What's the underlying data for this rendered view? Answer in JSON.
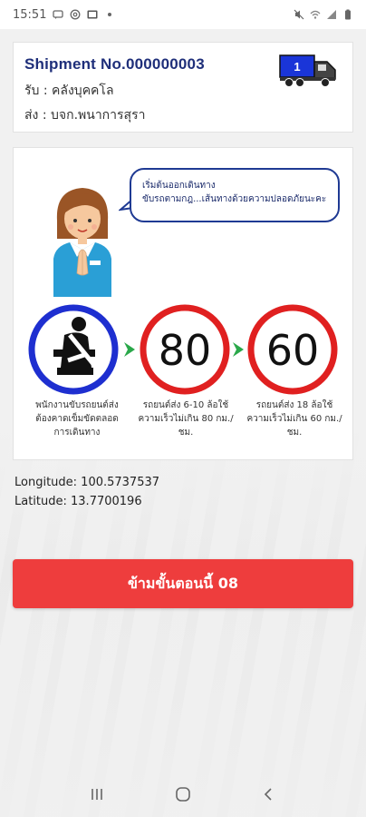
{
  "status_bar": {
    "time": "15:51",
    "icons_left": [
      "message-icon",
      "at-icon",
      "gallery-icon",
      "dot-icon"
    ],
    "icons_right": [
      "mute-icon",
      "wifi-icon",
      "signal-icon",
      "battery-icon"
    ]
  },
  "shipment": {
    "title": "Shipment No.000000003",
    "pickup": "รับ : คลังบุคคโล",
    "deliver": "ส่ง : บจก.พนาการสุรา",
    "truck_number": "1"
  },
  "safety": {
    "bubble_line1": "เริ่มต้นออกเดินทาง",
    "bubble_line2": "ขับรถตามกฎ...เส้นทางด้วยความปลอดภัยนะคะ",
    "seatbelt_caption": "พนักงานขับรถยนต์ส่ง ต้องคาดเข็มขัดตลอด การเดินทาง",
    "sign1_value": "80",
    "sign1_caption": "รถยนต์ส่ง 6-10 ล้อใช้ ความเร็วไม่เกิน 80 กม./ ชม.",
    "sign2_value": "60",
    "sign2_caption": "รถยนต์ส่ง 18 ล้อใช้ ความเร็วไม่เกิน 60 กม./ ชม."
  },
  "location": {
    "longitude": "Longitude: 100.5737537",
    "latitude": "Latitude: 13.7700196"
  },
  "skip_button": {
    "label": "ข้ามขั้นตอนนี้ 08"
  },
  "colors": {
    "primary_red": "#ee3d3d",
    "title_blue": "#1f2f7a",
    "sign_red": "#e02020",
    "seatbelt_blue": "#1e2fd0",
    "arrow_green": "#2aa84a"
  }
}
